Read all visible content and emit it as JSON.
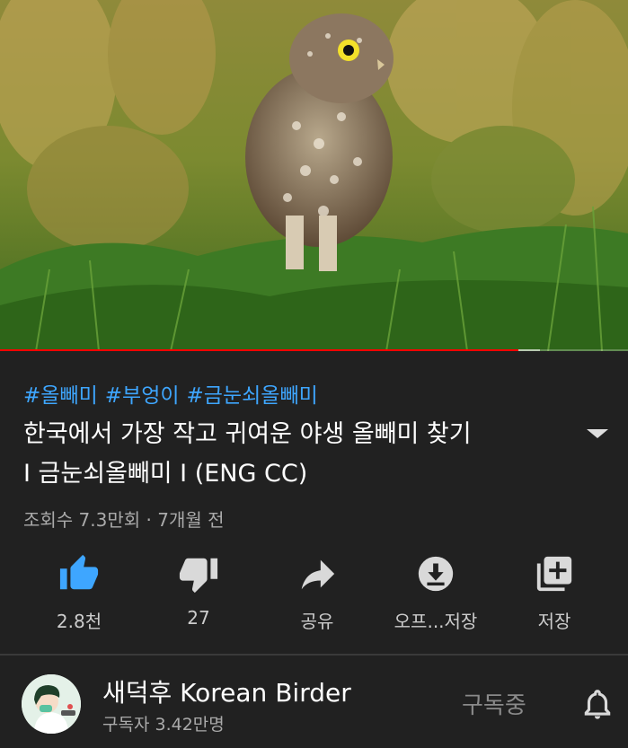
{
  "player": {
    "progress_fraction": 0.826,
    "buffer_fraction": 0.86,
    "progress_color": "#ff0000"
  },
  "video": {
    "hashtags": [
      "#올빼미",
      "#부엉이",
      "#금눈쇠올빼미"
    ],
    "title_line1": "한국에서 가장 작고 귀여운 야생 올빼미 찾기",
    "title_line2": "I 금눈쇠올빼미 I (ENG CC)",
    "meta": "조회수 7.3만회 · 7개월 전",
    "expand_icon": "chevron-down-icon"
  },
  "actions": [
    {
      "id": "like",
      "icon": "thumbs-up-icon",
      "label": "2.8천",
      "active": true
    },
    {
      "id": "dislike",
      "icon": "thumbs-down-icon",
      "label": "27",
      "active": false
    },
    {
      "id": "share",
      "icon": "share-icon",
      "label": "공유",
      "active": false
    },
    {
      "id": "offline",
      "icon": "download-icon",
      "label": "오프...저장",
      "active": false
    },
    {
      "id": "save",
      "icon": "playlist-add-icon",
      "label": "저장",
      "active": false
    }
  ],
  "channel": {
    "name": "새덕후 Korean Birder",
    "subscribers": "구독자 3.42만명",
    "subscribe_label": "구독중",
    "bell_icon": "bell-icon"
  },
  "colors": {
    "background": "#212121",
    "link": "#3ea6ff",
    "like_active": "#3ea6ff",
    "icon": "#d9d9d9"
  }
}
